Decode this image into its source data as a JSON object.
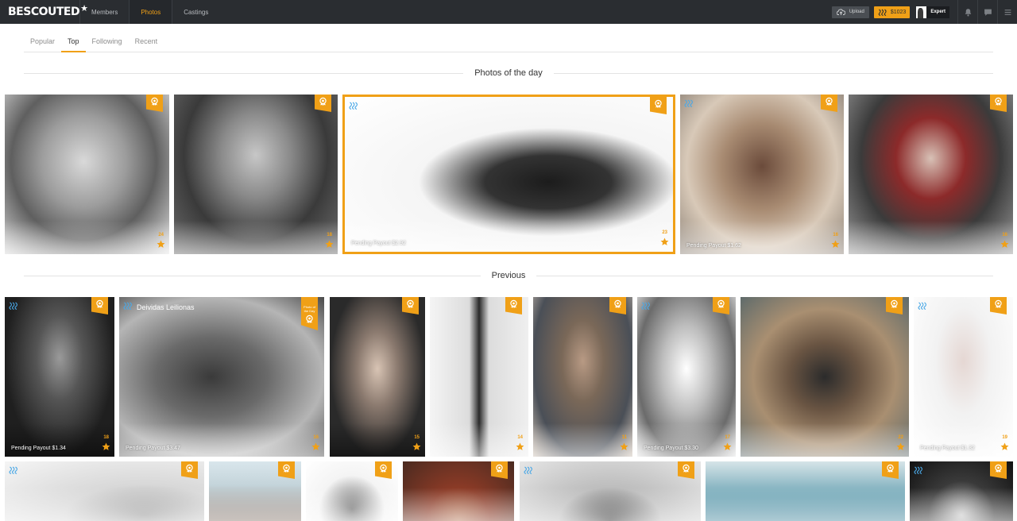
{
  "brand": {
    "logo": "BESCOUTED",
    "star": "★",
    "accent": "#f0a017",
    "dark": "#2a2d31"
  },
  "nav": [
    {
      "label": "Members",
      "active": false
    },
    {
      "label": "Photos",
      "active": true
    },
    {
      "label": "Castings",
      "active": false
    }
  ],
  "header_actions": {
    "upload_label": "Upload",
    "balance": "$1023",
    "expert_label": "Expert",
    "icons": [
      "cloud-upload-icon",
      "steem-icon",
      "bell-icon",
      "chat-icon",
      "menu-icon"
    ]
  },
  "subtabs": [
    {
      "label": "Popular",
      "active": false
    },
    {
      "label": "Top",
      "active": true
    },
    {
      "label": "Following",
      "active": false
    },
    {
      "label": "Recent",
      "active": false
    }
  ],
  "sections": {
    "day_title": "Photos of the day",
    "previous_title": "Previous"
  },
  "photos_of_day": [
    {
      "votes": "24",
      "payout": ""
    },
    {
      "votes": "18",
      "payout": ""
    },
    {
      "votes": "23",
      "payout": "Pending Payout $2.92"
    },
    {
      "votes": "16",
      "payout": "Pending Payout $1.62"
    },
    {
      "votes": "16",
      "payout": ""
    }
  ],
  "previous_photos": [
    {
      "votes": "18",
      "payout": "Pending Payout $1.34"
    },
    {
      "votes": "16",
      "payout": "Pending Payout $3.47",
      "owner": "Deividas Leilionas",
      "ribbon_text": "Photo of the Day"
    },
    {
      "votes": "15",
      "payout": ""
    },
    {
      "votes": "14",
      "payout": ""
    },
    {
      "votes": "11",
      "payout": ""
    },
    {
      "votes": "17",
      "payout": "Pending Payout $3.30"
    },
    {
      "votes": "22",
      "payout": ""
    },
    {
      "votes": "19",
      "payout": "Pending Payout $1.32"
    }
  ],
  "third_row_count": 8
}
